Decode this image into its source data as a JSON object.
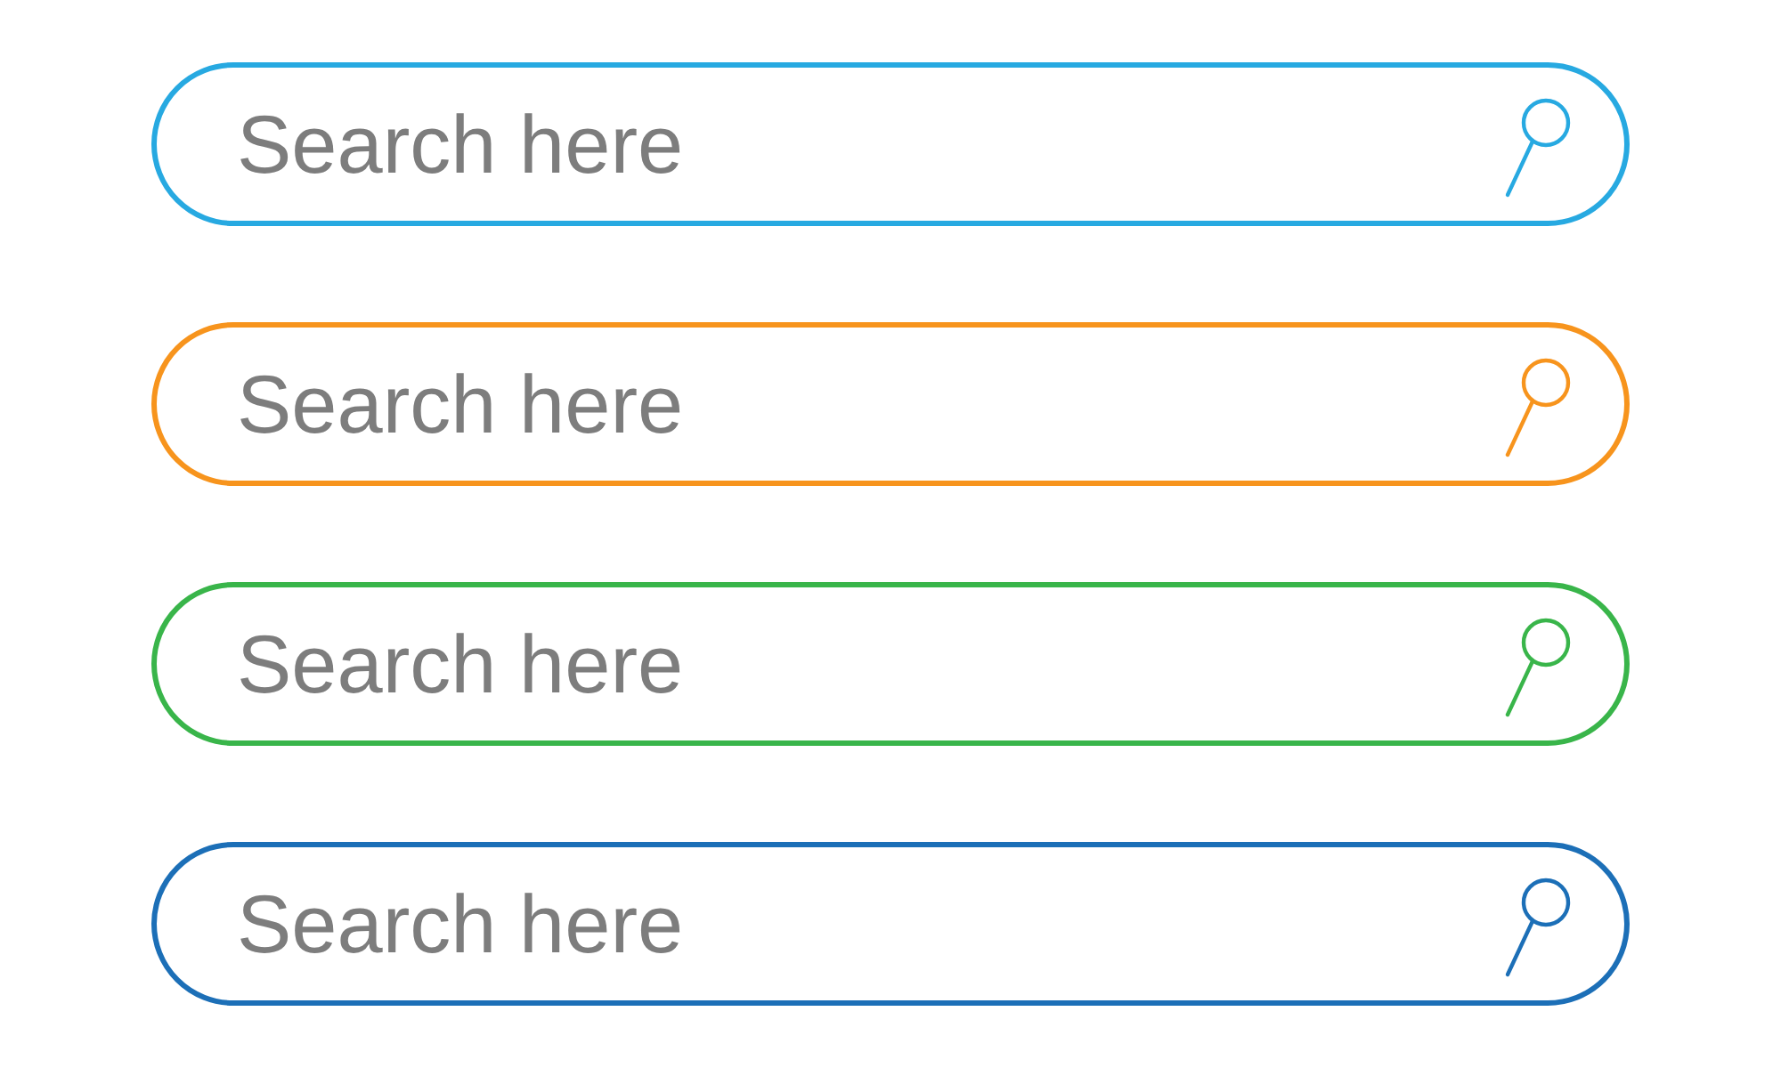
{
  "search_bars": [
    {
      "placeholder": "Search here",
      "color": "#27a9e1"
    },
    {
      "placeholder": "Search here",
      "color": "#f7941d"
    },
    {
      "placeholder": "Search here",
      "color": "#39b54a"
    },
    {
      "placeholder": "Search here",
      "color": "#1c6fb7"
    }
  ]
}
